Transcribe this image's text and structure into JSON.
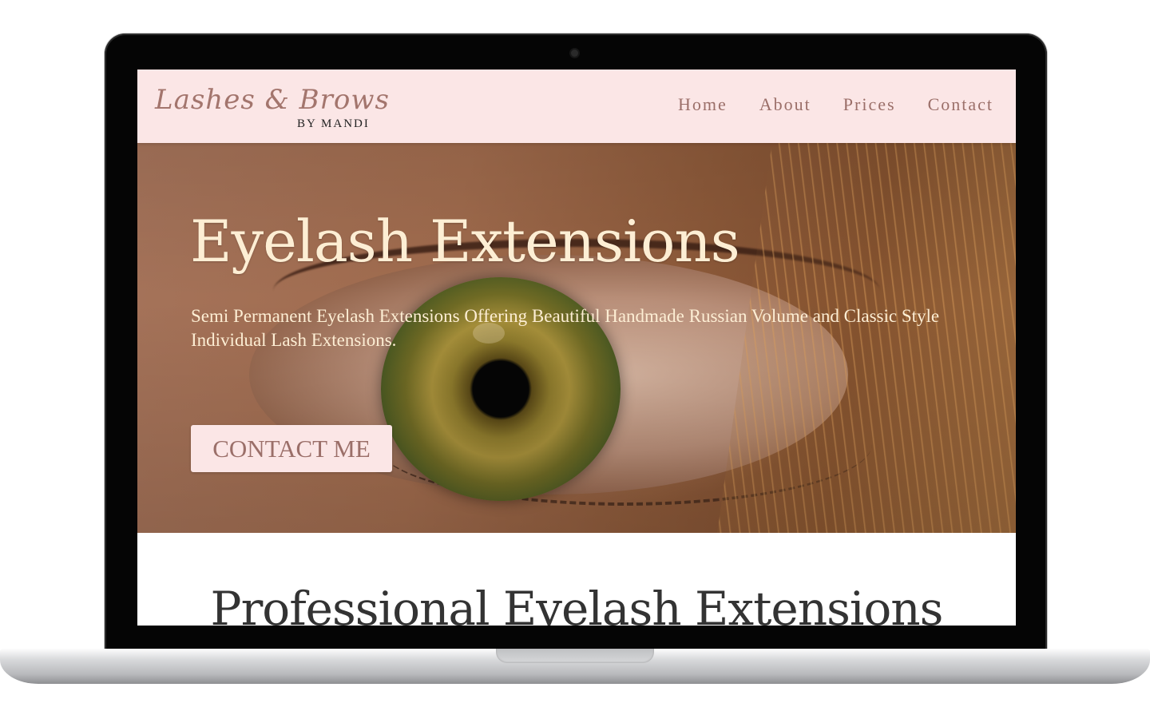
{
  "brand": {
    "script": "Lashes & Brows",
    "sub": "BY MANDI"
  },
  "nav": {
    "items": [
      {
        "label": "Home"
      },
      {
        "label": "About"
      },
      {
        "label": "Prices"
      },
      {
        "label": "Contact"
      }
    ]
  },
  "hero": {
    "title": "Eyelash Extensions",
    "subtitle": "Semi Permanent Eyelash Extensions Offering Beautiful Handmade Russian Volume and Classic Style Individual Lash Extensions.",
    "cta_label": "CONTACT ME"
  },
  "section": {
    "heading": "Professional Eyelash Extensions"
  },
  "colors": {
    "header_bg": "#fbe6e6",
    "accent": "#9b6f69",
    "hero_text": "#fdeed4",
    "heading_text": "#333333",
    "frame": "#050505"
  }
}
